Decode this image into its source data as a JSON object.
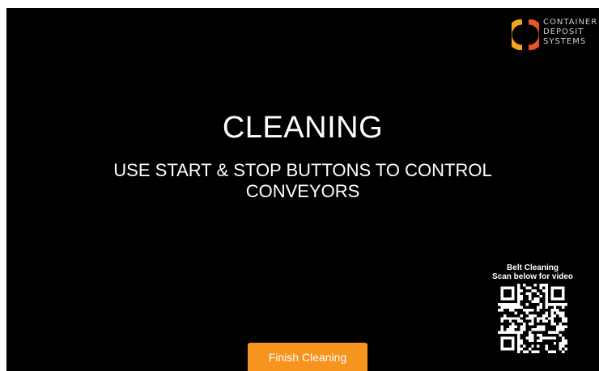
{
  "brand": {
    "lines": [
      "CONTAINER",
      "DEPOSIT",
      "SYSTEMS"
    ],
    "logo_icon": "cds-logo-icon",
    "logo_colors": [
      "#f7a21b",
      "#e8542a"
    ]
  },
  "main": {
    "title": "CLEANING",
    "instruction": "USE START & STOP BUTTONS TO CONTROL CONVEYORS"
  },
  "qr": {
    "caption_line1": "Belt Cleaning",
    "caption_line2": "Scan below for video",
    "icon": "qr-code-icon"
  },
  "actions": {
    "finish_label": "Finish Cleaning",
    "finish_color": "#f7941d"
  },
  "colors": {
    "background": "#000000",
    "text": "#ffffff",
    "accent": "#f7941d"
  }
}
